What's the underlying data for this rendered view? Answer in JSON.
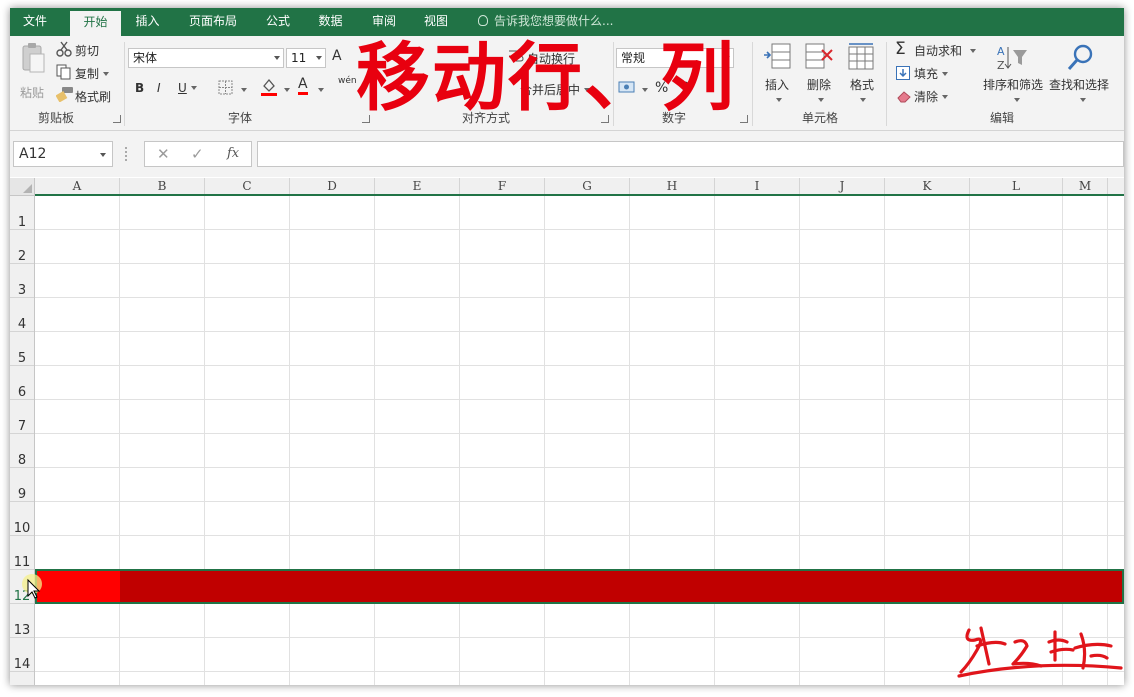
{
  "tabs": [
    {
      "label": "文件",
      "left": 0,
      "width": 50,
      "active": false
    },
    {
      "label": "开始",
      "active": true
    },
    {
      "label": "插入"
    },
    {
      "label": "页面布局"
    },
    {
      "label": "公式"
    },
    {
      "label": "数据"
    },
    {
      "label": "审阅"
    },
    {
      "label": "视图"
    }
  ],
  "tell_me": "告诉我您想要做什么...",
  "overlay_title": "移动行、列",
  "clipboard": {
    "paste": "粘贴",
    "cut": "剪切",
    "copy": "复制",
    "format_painter": "格式刷",
    "label": "剪贴板"
  },
  "font": {
    "name": "宋体",
    "size": "11",
    "bold": "B",
    "italic": "I",
    "underline": "U",
    "grow": "A",
    "font_color": "A",
    "phonetic": "wén",
    "label": "字体"
  },
  "alignment": {
    "wrap_text": "自动换行",
    "merge_center": "合并后居中",
    "label": "对齐方式"
  },
  "number": {
    "format": "常规",
    "percent": "%",
    "comma": "9",
    "label": "数字"
  },
  "cells_group": {
    "insert": "插入",
    "delete": "删除",
    "format": "格式",
    "label": "单元格"
  },
  "editing": {
    "autosum": "自动求和",
    "fill": "填充",
    "clear": "清除",
    "sort_filter": "排序和筛选",
    "find_select": "查找和选择",
    "label": "编辑"
  },
  "formula_bar": {
    "name_box": "A12",
    "cancel": "✕",
    "enter": "✓",
    "fx": "fx",
    "value": ""
  },
  "columns": [
    "A",
    "B",
    "C",
    "D",
    "E",
    "F",
    "G",
    "H",
    "I",
    "J",
    "K",
    "L",
    "M"
  ],
  "rows": [
    "1",
    "2",
    "3",
    "4",
    "5",
    "6",
    "7",
    "8",
    "9",
    "10",
    "11",
    "12",
    "13",
    "14"
  ],
  "colors": {
    "accent": "#217346",
    "fill_red": "#ff0000",
    "fill_dark_red": "#c00000",
    "overlay_red": "#e8000f"
  },
  "signature_text": "张之峰"
}
